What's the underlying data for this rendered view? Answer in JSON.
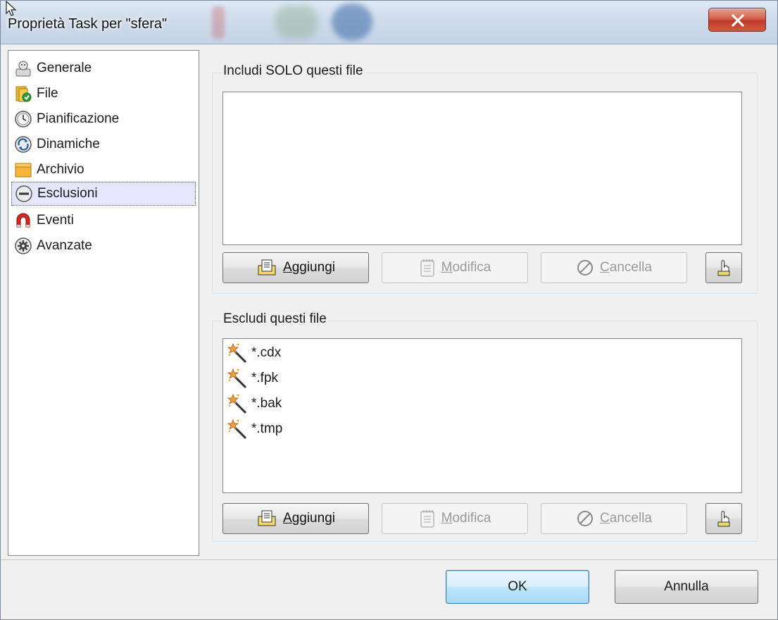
{
  "window": {
    "title": "Proprietà Task per \"sfera\""
  },
  "sidebar": {
    "items": [
      {
        "label": "Generale",
        "icon": "user-card-icon"
      },
      {
        "label": "File",
        "icon": "file-check-icon"
      },
      {
        "label": "Pianificazione",
        "icon": "clock-icon"
      },
      {
        "label": "Dinamiche",
        "icon": "refresh-icon"
      },
      {
        "label": "Archivio",
        "icon": "folder-icon"
      },
      {
        "label": "Esclusioni",
        "icon": "minus-circle-icon",
        "selected": true
      },
      {
        "label": "Eventi",
        "icon": "magnet-icon"
      },
      {
        "label": "Avanzate",
        "icon": "gear-icon"
      }
    ]
  },
  "include_group": {
    "title": "Includi SOLO questi file",
    "items": [],
    "buttons": {
      "add": {
        "prefix": "",
        "hotkey": "A",
        "rest": "ggiungi"
      },
      "edit": {
        "hotkey": "M",
        "rest": "odifica"
      },
      "delete": {
        "hotkey": "C",
        "rest": "ancella"
      }
    }
  },
  "exclude_group": {
    "title": "Escludi questi file",
    "items": [
      "*.cdx",
      "*.fpk",
      "*.bak",
      "*.tmp"
    ],
    "buttons": {
      "add": {
        "hotkey": "A",
        "rest": "ggiungi"
      },
      "edit": {
        "hotkey": "M",
        "rest": "odifica"
      },
      "delete": {
        "hotkey": "C",
        "rest": "ancella"
      }
    }
  },
  "footer": {
    "ok": "OK",
    "cancel": "Annulla"
  }
}
